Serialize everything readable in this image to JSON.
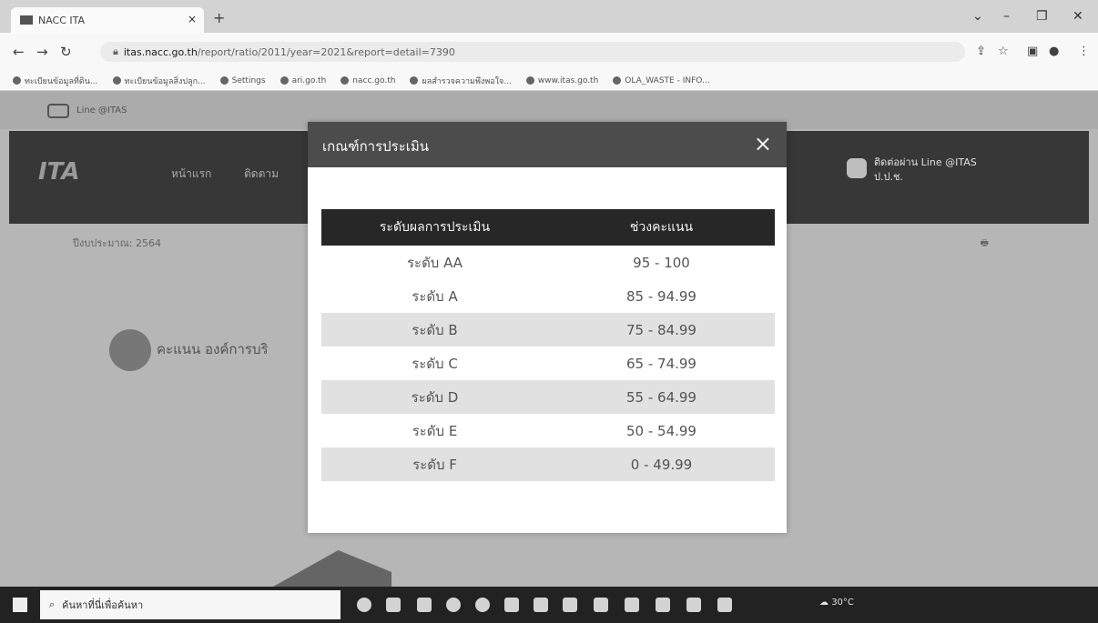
{
  "browser": {
    "tab_title": "NACC ITA",
    "url_host": "itas.nacc.go.th",
    "url_path": "/report/ratio/2011/year=2021&report=detail=7390"
  },
  "bookmarks": [
    "ทะเบียนข้อมูลที่ดิน...",
    "ทะเบียนข้อมูลสิ่งปลูก...",
    "Settings",
    "ari.go.th",
    "nacc.go.th",
    "ผลสำรวจความพึงพอใจ...",
    "www.itas.go.th",
    "OLA_WASTE - INFO..."
  ],
  "page": {
    "line_label": "Line @ITAS",
    "brand": "ITA",
    "menu": [
      "หน้าแรก",
      "ติดตาม"
    ],
    "chat_text": "ติดต่อผ่าน Line @ITAS",
    "chat_sub": "ป.ป.ช.",
    "year_label": "ปีงบประมาณ: 2564",
    "org_label": "คะแนน องค์การบริ"
  },
  "modal": {
    "title": "เกณฑ์การประเมิน",
    "columns": [
      "ระดับผลการประเมิน",
      "ช่วงคะแนน"
    ],
    "rows": [
      {
        "level": "ระดับ AA",
        "range": "95 - 100",
        "shaded": false
      },
      {
        "level": "ระดับ A",
        "range": "85 - 94.99",
        "shaded": false
      },
      {
        "level": "ระดับ B",
        "range": "75 - 84.99",
        "shaded": true
      },
      {
        "level": "ระดับ C",
        "range": "65 - 74.99",
        "shaded": false
      },
      {
        "level": "ระดับ D",
        "range": "55 - 64.99",
        "shaded": true
      },
      {
        "level": "ระดับ E",
        "range": "50 - 54.99",
        "shaded": false
      },
      {
        "level": "ระดับ F",
        "range": "0 - 49.99",
        "shaded": true
      }
    ]
  },
  "taskbar": {
    "search_placeholder": "ค้นหาที่นี่เพื่อค้นหา",
    "temperature": "30°C"
  },
  "icons": {
    "close": "×",
    "search": "⌕"
  }
}
